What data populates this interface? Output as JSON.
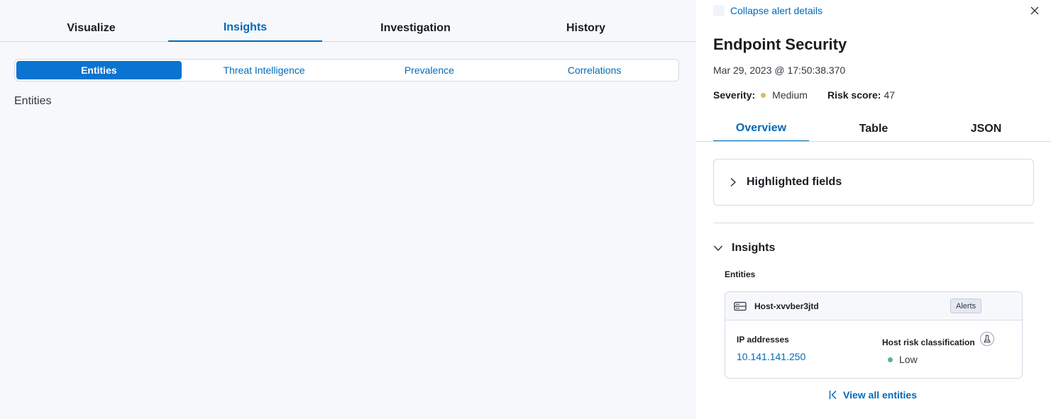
{
  "left": {
    "main_tabs": [
      "Visualize",
      "Insights",
      "Investigation",
      "History"
    ],
    "active_main_tab": "Insights",
    "sub_tabs": [
      "Entities",
      "Threat Intelligence",
      "Prevalence",
      "Correlations"
    ],
    "active_sub_tab": "Entities",
    "heading": "Entities"
  },
  "right": {
    "collapse_label": "Collapse alert details",
    "title": "Endpoint Security",
    "timestamp": "Mar 29, 2023 @ 17:50:38.370",
    "severity_label": "Severity:",
    "severity_value": "Medium",
    "risk_label": "Risk score:",
    "risk_value": "47",
    "tabs": [
      "Overview",
      "Table",
      "JSON"
    ],
    "active_tab": "Overview",
    "highlighted_fields": "Highlighted fields",
    "insights_title": "Insights",
    "entities_label": "Entities",
    "entity": {
      "host_name": "Host-xvvber3jtd",
      "badge": "Alerts",
      "ip_label": "IP addresses",
      "ip_value": "10.141.141.250",
      "risk_label": "Host risk classification",
      "risk_value": "Low"
    },
    "view_all": "View all entities"
  },
  "colors": {
    "accent": "#006bb8",
    "active_subtab_bg": "#0b74d0",
    "severity_medium": "#d6bf57",
    "risk_low": "#54b399"
  },
  "icons": [
    "close-icon",
    "chevron-right-icon",
    "chevron-down-icon",
    "host-icon",
    "beta-icon",
    "arrow-start-icon"
  ]
}
